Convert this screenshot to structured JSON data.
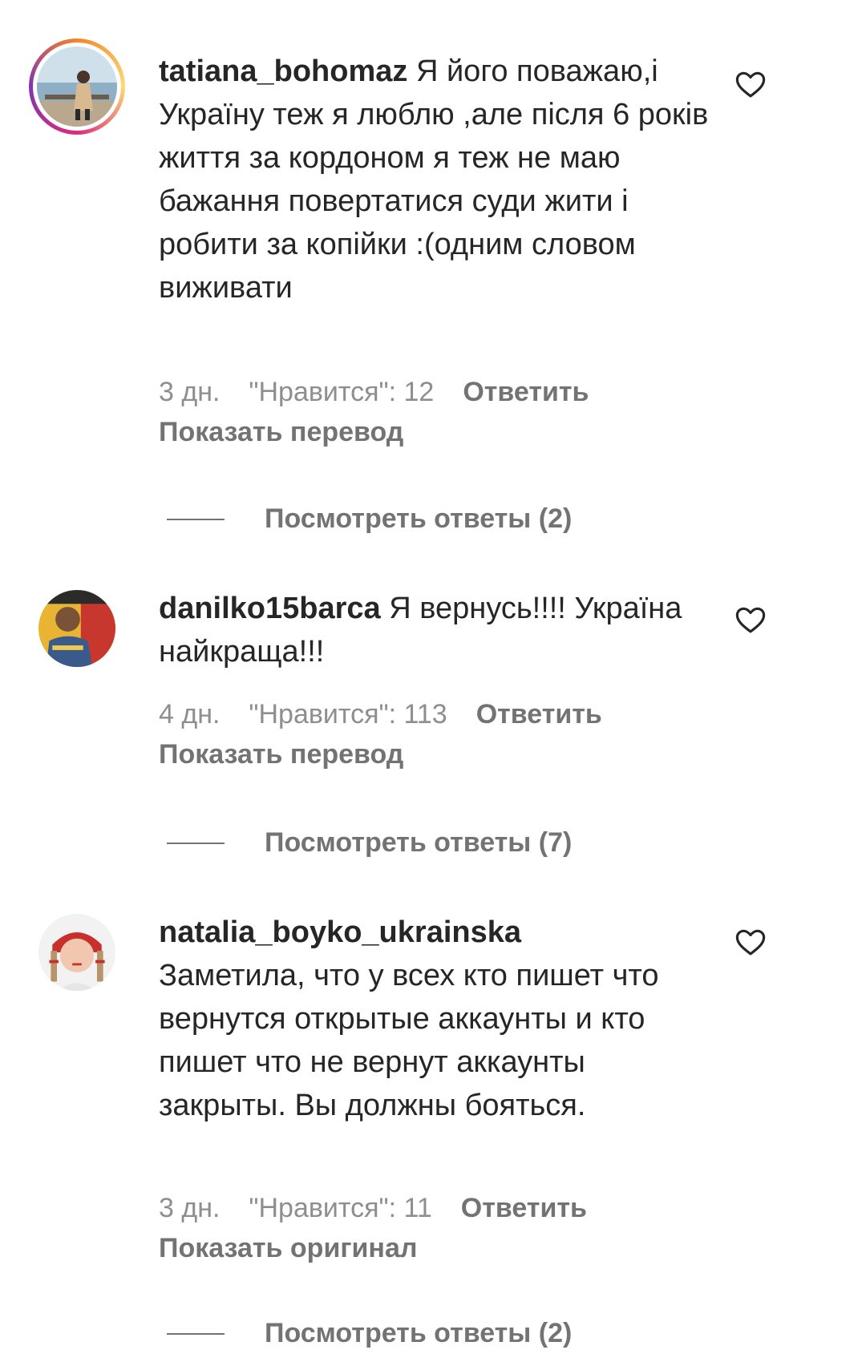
{
  "comments": [
    {
      "username": "tatiana_bohomaz",
      "text": "Я його поважаю,і Україну теж я люблю ,але після 6 років життя за кордоном я теж не маю бажання повертатися суди жити і робити за копійки :(одним словом виживати",
      "time": "3 дн.",
      "likes": "\"Нравится\": 12",
      "reply": "Ответить",
      "translate": "Показать перевод",
      "view_replies": "Посмотреть ответы (2)"
    },
    {
      "username": "danilko15barca",
      "text": "Я вернусь!!!! Україна найкраща!!!",
      "time": "4 дн.",
      "likes": "\"Нравится\": 113",
      "reply": "Ответить",
      "translate": "Показать перевод",
      "view_replies": "Посмотреть ответы (7)"
    },
    {
      "username": "natalia_boyko_ukrainska",
      "text": "Заметила, что у всех кто пишет что вернутся открытые аккаунты и кто пишет что не вернут аккаунты закрыты. Вы должны бояться.",
      "time": "3 дн.",
      "likes": "\"Нравится\": 11",
      "reply": "Ответить",
      "translate": "Показать оригинал",
      "view_replies": "Посмотреть ответы (2)"
    }
  ],
  "icons": {
    "like": "heart-outline-icon"
  },
  "colors": {
    "text": "#262626",
    "secondary": "#8e8e8e",
    "story_ring": "gradient"
  }
}
